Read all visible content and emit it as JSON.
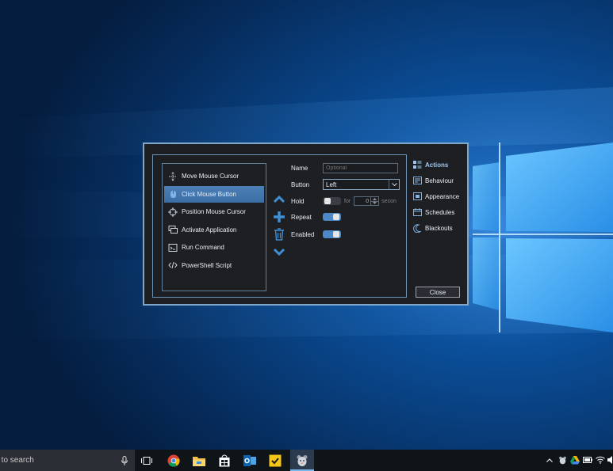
{
  "dialog": {
    "actions": [
      {
        "label": "Move Mouse Cursor",
        "icon": "move-cursor-icon"
      },
      {
        "label": "Click Mouse Button",
        "icon": "mouse-click-icon",
        "selected": true
      },
      {
        "label": "Position Mouse Cursor",
        "icon": "crosshair-icon"
      },
      {
        "label": "Activate Application",
        "icon": "window-icon"
      },
      {
        "label": "Run Command",
        "icon": "terminal-icon"
      },
      {
        "label": "PowerShell Script",
        "icon": "code-icon"
      }
    ],
    "form": {
      "name_label": "Name",
      "name_placeholder": "Optional",
      "button_label": "Button",
      "button_value": "Left",
      "hold_label": "Hold",
      "hold_for": "for",
      "hold_value": "0",
      "hold_unit": "secon",
      "repeat_label": "Repeat",
      "enabled_label": "Enabled",
      "hold_on": false,
      "repeat_on": true,
      "enabled_on": true
    },
    "nav": [
      {
        "label": "Actions",
        "icon": "actions-icon",
        "active": true
      },
      {
        "label": "Behaviour",
        "icon": "behaviour-icon"
      },
      {
        "label": "Appearance",
        "icon": "appearance-icon"
      },
      {
        "label": "Schedules",
        "icon": "calendar-icon"
      },
      {
        "label": "Blackouts",
        "icon": "moon-icon"
      }
    ],
    "close_label": "Close",
    "accent_color": "#4a88c7"
  },
  "taskbar": {
    "search_text": "re to search",
    "apps": [
      "task-view-icon",
      "chrome-icon",
      "file-explorer-icon",
      "store-icon",
      "outlook-icon",
      "norton-icon",
      "mouse-app-icon"
    ]
  }
}
